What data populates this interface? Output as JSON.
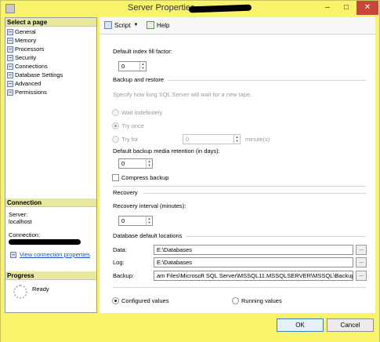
{
  "window": {
    "title": "Server Properties",
    "minimize_glyph": "‒",
    "maximize_glyph": "□",
    "close_glyph": "✕"
  },
  "left": {
    "select_page_heading": "Select a page",
    "pages": [
      "General",
      "Memory",
      "Processors",
      "Security",
      "Connections",
      "Database Settings",
      "Advanced",
      "Permissions"
    ],
    "connection_heading": "Connection",
    "server_label": "Server:",
    "server_value": "localhost",
    "connection_label": "Connection:",
    "view_connection_link": "View connection properties",
    "progress_heading": "Progress",
    "progress_status": "Ready"
  },
  "toolbar": {
    "script_label": "Script",
    "dropdown_glyph": "▼",
    "help_label": "Help"
  },
  "settings": {
    "fill_factor_label": "Default index fill factor:",
    "fill_factor_value": "0",
    "backup_restore_heading": "Backup and restore",
    "backup_hint": "Specify how long SQL Server will wait for a new tape.",
    "wait_indefinitely_label": "Wait indefinitely",
    "try_once_label": "Try once",
    "try_for_label": "Try for",
    "try_for_value": "0",
    "minutes_label": "minute(s)",
    "retention_label": "Default backup media retention (in days):",
    "retention_value": "0",
    "compress_label": "Compress backup",
    "recovery_heading": "Recovery",
    "recovery_interval_label": "Recovery interval (minutes):",
    "recovery_interval_value": "0",
    "locations_heading": "Database default locations",
    "data_label": "Data:",
    "data_value": "E:\\Databases",
    "log_label": "Log:",
    "log_value": "E:\\Databases",
    "backup_label": "Backup:",
    "backup_value": "am Files\\Microsoft SQL Server\\MSSQL11.MSSQLSERVER\\MSSQL\\Backup",
    "browse_label": "...",
    "configured_values_label": "Configured values",
    "running_values_label": "Running values"
  },
  "buttons": {
    "ok_label": "OK",
    "cancel_label": "Cancel"
  }
}
